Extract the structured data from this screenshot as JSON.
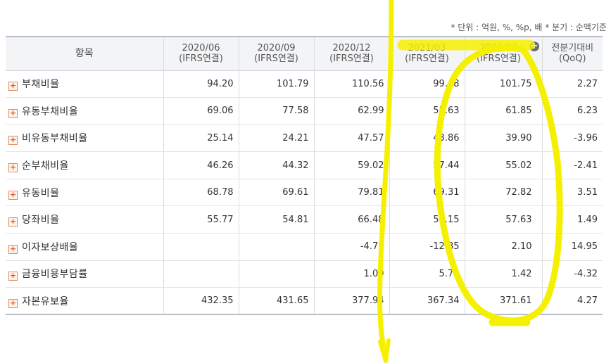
{
  "unit_note": "* 단위 : 억원, %, %p, 배    * 분기 : 순액기준",
  "header": {
    "item": "항목",
    "periods": [
      {
        "date": "2020/06",
        "basis": "(IFRS연결)"
      },
      {
        "date": "2020/09",
        "basis": "(IFRS연결)"
      },
      {
        "date": "2020/12",
        "basis": "(IFRS연결)"
      },
      {
        "date": "2021/03",
        "basis": "(IFRS연결)"
      },
      {
        "date": "2021/06",
        "basis": "(IFRS연결)"
      }
    ],
    "qoq_line1": "전분기대비",
    "qoq_line2": "(QoQ)"
  },
  "expand_symbol": "+",
  "add_symbol": "+",
  "rows": [
    {
      "label": "부채비율",
      "values": [
        "94.20",
        "101.79",
        "110.56",
        "99.48",
        "101.75",
        "2.27"
      ]
    },
    {
      "label": "유동부채비율",
      "values": [
        "69.06",
        "77.58",
        "62.99",
        "55.63",
        "61.85",
        "6.23"
      ]
    },
    {
      "label": "비유동부채비율",
      "values": [
        "25.14",
        "24.21",
        "47.57",
        "43.86",
        "39.90",
        "-3.96"
      ]
    },
    {
      "label": "순부채비율",
      "values": [
        "46.26",
        "44.32",
        "59.02",
        "57.44",
        "55.02",
        "-2.41"
      ]
    },
    {
      "label": "유동비율",
      "values": [
        "68.78",
        "69.61",
        "79.81",
        "69.31",
        "72.82",
        "3.51"
      ]
    },
    {
      "label": "당좌비율",
      "values": [
        "55.77",
        "54.81",
        "66.48",
        "56.15",
        "57.63",
        "1.49"
      ]
    },
    {
      "label": "이자보상배율",
      "values": [
        "",
        "",
        "-4.79",
        "-12.85",
        "2.10",
        "14.95"
      ]
    },
    {
      "label": "금융비용부담률",
      "values": [
        "",
        "",
        "1.09",
        "5.75",
        "1.42",
        "-4.32"
      ]
    },
    {
      "label": "자본유보율",
      "values": [
        "432.35",
        "431.65",
        "377.94",
        "367.34",
        "371.61",
        "4.27"
      ]
    }
  ],
  "colors": {
    "negative": "#e02020",
    "highlight": "#f5f000"
  }
}
